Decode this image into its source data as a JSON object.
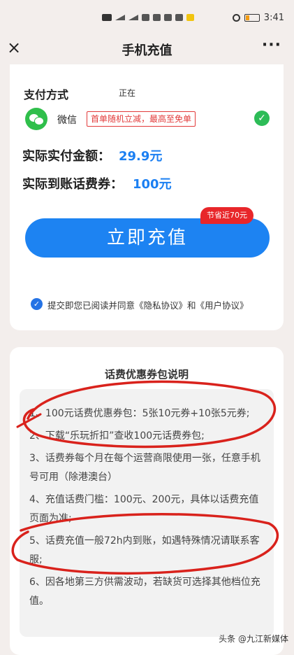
{
  "status_bar": {
    "time": "3:41"
  },
  "nav": {
    "title": "手机充值",
    "close_icon": "×",
    "more_icon": "···"
  },
  "payment": {
    "section_title": "支付方式",
    "status_text": "正在",
    "method_label": "微信",
    "promo_text": "首单随机立减，最高至免单",
    "method_icon": "wechat-icon",
    "selected_icon": "check-icon"
  },
  "amounts": {
    "actual_pay_label": "实际实付金额：",
    "actual_pay_value": "29.9元",
    "credit_label": "实际到账话费券：",
    "credit_value": "100元"
  },
  "recharge": {
    "save_badge": "节省近70元",
    "button_label": "立即充值"
  },
  "agreement": {
    "text": "提交即您已阅读并同意《隐私协议》和《用户协议》"
  },
  "info": {
    "title": "话费优惠券包说明",
    "items": [
      "1、100元话费优惠券包：5张10元券+10张5元券;",
      "2、下载“乐玩折扣”查收100元话费券包;",
      "3、话费券每个月在每个运营商限使用一张，任意手机号可用（除港澳台）",
      "4、充值话费门槛：100元、200元，具体以话费充值页面为准;",
      "5、话费充值一般72h内到账，如遇特殊情况请联系客服;",
      "6、因各地第三方供需波动，若缺货可选择其他档位充值。"
    ]
  },
  "watermark": "头条 @九江新媒体",
  "colors": {
    "accent": "#1d83f2",
    "promo_red": "#e23a3a",
    "wechat_green": "#2fbf4b",
    "annotation_red": "#d9221c"
  }
}
